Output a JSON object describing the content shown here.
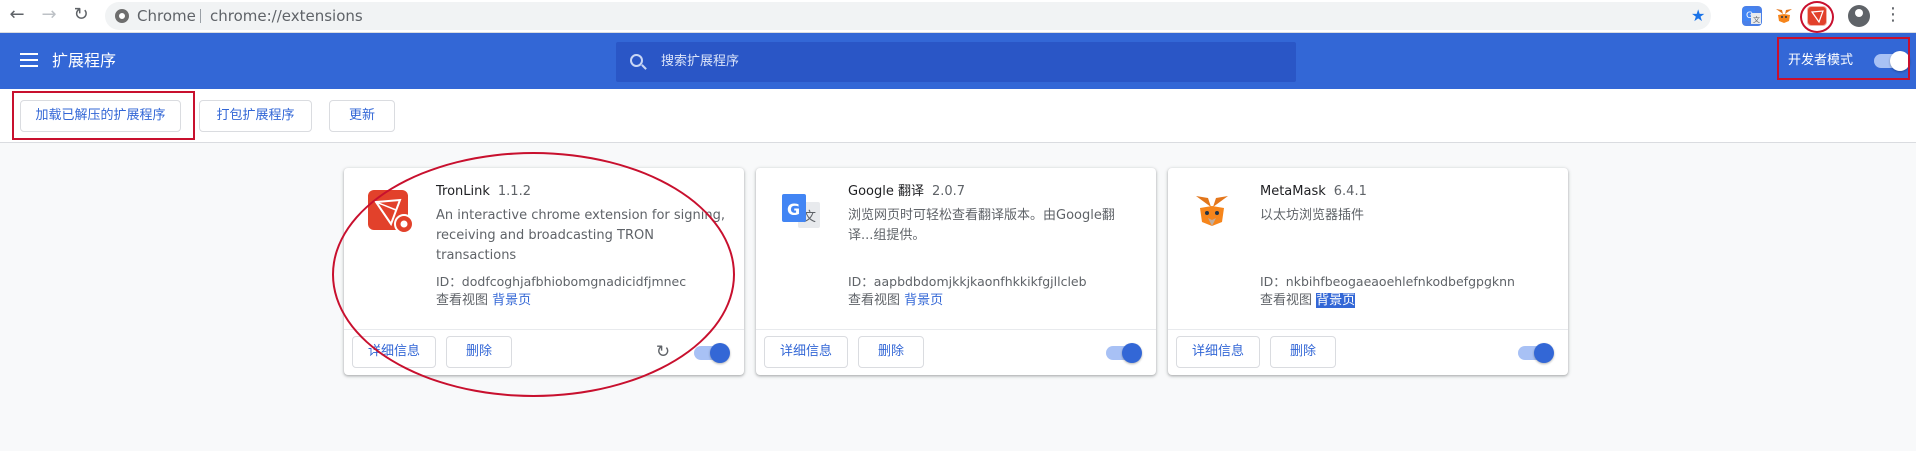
{
  "browser": {
    "back_icon": "arrow-left-icon",
    "forward_icon": "arrow-right-icon",
    "reload_icon": "reload-icon",
    "site_name": "Chrome",
    "url": "chrome://extensions",
    "bookmark_icon": "star-icon",
    "menu_icon": "more-vert-icon"
  },
  "header": {
    "title": "扩展程序",
    "search_placeholder": "搜索扩展程序",
    "dev_mode_label": "开发者模式",
    "dev_mode_on": true,
    "accent_color": "#3367d6"
  },
  "toolbar": {
    "load_unpacked": "加载已解压的扩展程序",
    "pack_extension": "打包扩展程序",
    "update": "更新"
  },
  "extensions": [
    {
      "name": "TronLink",
      "version": "1.1.2",
      "description": "An interactive chrome extension for signing, receiving and broadcasting TRON transactions",
      "id_line": "ID：dodfcoghjafbhiobomgnadicidfjmnec",
      "views_label": "查看视图",
      "views_link": "背景页",
      "details": "详细信息",
      "remove": "删除",
      "enabled": true,
      "icon": "tronlink-icon"
    },
    {
      "name": "Google 翻译",
      "version": "2.0.7",
      "description": "浏览网页时可轻松查看翻译版本。由Google翻译...组提供。",
      "id_line": "ID：aapbdbdomjkkjkaonfhkkikfgjllcleb",
      "views_label": "查看视图",
      "views_link": "背景页",
      "details": "详细信息",
      "remove": "删除",
      "enabled": true,
      "icon": "google-translate-icon"
    },
    {
      "name": "MetaMask",
      "version": "6.4.1",
      "description": "以太坊浏览器插件",
      "id_line": "ID：nkbihfbeogaeaoehlefnkodbefgpgknn",
      "views_label": "查看视图",
      "views_link": "背景页",
      "details": "详细信息",
      "remove": "删除",
      "enabled": true,
      "icon": "metamask-fox-icon"
    }
  ]
}
